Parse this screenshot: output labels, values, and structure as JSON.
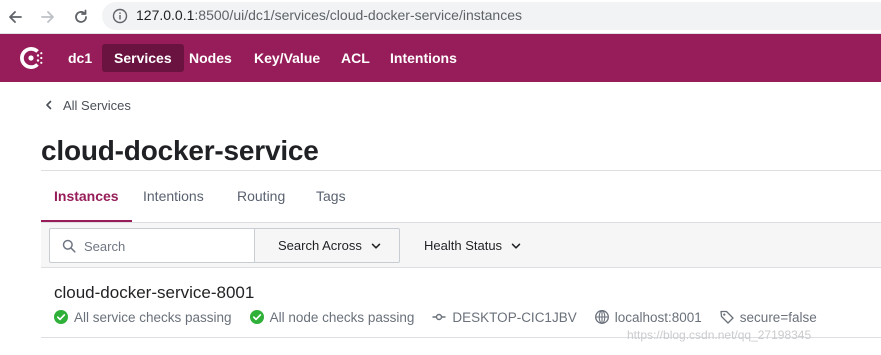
{
  "browser": {
    "url_host": "127.0.0.1",
    "url_path": ":8500/ui/dc1/services/cloud-docker-service/instances"
  },
  "topnav": {
    "datacenter": "dc1",
    "items": [
      {
        "label": "Services",
        "active": true
      },
      {
        "label": "Nodes",
        "active": false
      },
      {
        "label": "Key/Value",
        "active": false
      },
      {
        "label": "ACL",
        "active": false
      },
      {
        "label": "Intentions",
        "active": false
      }
    ]
  },
  "breadcrumb": {
    "label": "All Services"
  },
  "page": {
    "title": "cloud-docker-service"
  },
  "tabs": [
    {
      "label": "Instances",
      "active": true
    },
    {
      "label": "Intentions",
      "active": false
    },
    {
      "label": "Routing",
      "active": false
    },
    {
      "label": "Tags",
      "active": false
    }
  ],
  "filters": {
    "search_placeholder": "Search",
    "search_value": "",
    "search_across_label": "Search Across",
    "health_status_label": "Health Status"
  },
  "instances": [
    {
      "name": "cloud-docker-service-8001",
      "service_checks": "All service checks passing",
      "node_checks": "All node checks passing",
      "node": "DESKTOP-CIC1JBV",
      "address": "localhost:8001",
      "tag": "secure=false"
    }
  ],
  "watermark": "https://blog.csdn.net/qq_27198345",
  "colors": {
    "brand": "#961d59",
    "brand_active": "#6a1340",
    "check_passing": "#2eb039"
  }
}
